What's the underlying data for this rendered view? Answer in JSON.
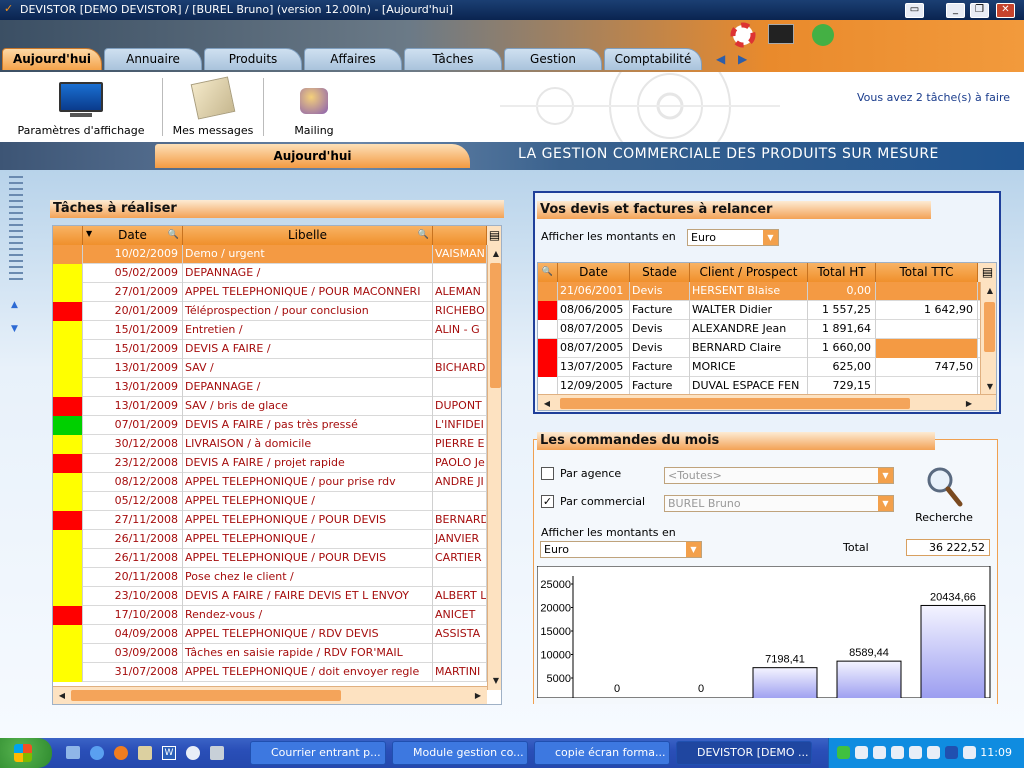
{
  "window": {
    "title": "DEVISTOR [DEMO DEVISTOR] / [BUREL Bruno] (version 12.00In) - [Aujourd'hui]"
  },
  "nav": {
    "tabs": [
      {
        "label": "Aujourd'hui",
        "active": true
      },
      {
        "label": "Annuaire"
      },
      {
        "label": "Produits"
      },
      {
        "label": "Affaires"
      },
      {
        "label": "Tâches"
      },
      {
        "label": "Gestion"
      },
      {
        "label": "Comptabilité"
      }
    ]
  },
  "toolbar": {
    "display_settings": "Paramètres d'affichage",
    "messages": "Mes messages",
    "mailing": "Mailing",
    "tasks_notice": "Vous avez 2 tâche(s) à faire"
  },
  "section": {
    "title": "Aujourd'hui",
    "slogan": "LA GESTION COMMERCIALE DES PRODUITS SUR MESURE"
  },
  "tasks": {
    "title": "Tâches à réaliser",
    "columns": {
      "date": "Date",
      "label": "Libelle"
    },
    "rows": [
      {
        "status": "orange",
        "date": "10/02/2009",
        "label": "Demo / urgent",
        "client": "VAISMAN",
        "selected": true
      },
      {
        "status": "yellow",
        "date": "05/02/2009",
        "label": "DEPANNAGE /",
        "client": ""
      },
      {
        "status": "yellow",
        "date": "27/01/2009",
        "label": "APPEL TELEPHONIQUE / POUR MACONNERI",
        "client": "ALEMAN"
      },
      {
        "status": "red",
        "date": "20/01/2009",
        "label": "Téléprospection / pour conclusion",
        "client": "RICHEBO"
      },
      {
        "status": "yellow",
        "date": "15/01/2009",
        "label": "Entretien /",
        "client": "ALIN  - G"
      },
      {
        "status": "yellow",
        "date": "15/01/2009",
        "label": "DEVIS A FAIRE /",
        "client": ""
      },
      {
        "status": "yellow",
        "date": "13/01/2009",
        "label": "SAV /",
        "client": "BICHARD"
      },
      {
        "status": "yellow",
        "date": "13/01/2009",
        "label": "DEPANNAGE /",
        "client": ""
      },
      {
        "status": "red",
        "date": "13/01/2009",
        "label": "SAV / bris de glace",
        "client": "DUPONT"
      },
      {
        "status": "green",
        "date": "07/01/2009",
        "label": "DEVIS A FAIRE / pas très pressé",
        "client": "L'INFIDEI"
      },
      {
        "status": "yellow",
        "date": "30/12/2008",
        "label": "LIVRAISON / à domicile",
        "client": "PIERRE E"
      },
      {
        "status": "red",
        "date": "23/12/2008",
        "label": "DEVIS A FAIRE / projet rapide",
        "client": "PAOLO Je"
      },
      {
        "status": "yellow",
        "date": "08/12/2008",
        "label": "APPEL TELEPHONIQUE / pour prise rdv",
        "client": "ANDRE JI"
      },
      {
        "status": "yellow",
        "date": "05/12/2008",
        "label": "APPEL TELEPHONIQUE /",
        "client": ""
      },
      {
        "status": "red",
        "date": "27/11/2008",
        "label": "APPEL TELEPHONIQUE / POUR DEVIS",
        "client": "BERNARD"
      },
      {
        "status": "yellow",
        "date": "26/11/2008",
        "label": "APPEL TELEPHONIQUE /",
        "client": "JANVIER"
      },
      {
        "status": "yellow",
        "date": "26/11/2008",
        "label": "APPEL TELEPHONIQUE / POUR DEVIS",
        "client": "CARTIER"
      },
      {
        "status": "yellow",
        "date": "20/11/2008",
        "label": "Pose chez le client /",
        "client": ""
      },
      {
        "status": "yellow",
        "date": "23/10/2008",
        "label": "DEVIS A FAIRE / FAIRE DEVIS ET L ENVOY",
        "client": "ALBERT L"
      },
      {
        "status": "red",
        "date": "17/10/2008",
        "label": "Rendez-vous /",
        "client": "ANICET"
      },
      {
        "status": "yellow",
        "date": "04/09/2008",
        "label": "APPEL TELEPHONIQUE / RDV DEVIS",
        "client": "ASSISTA"
      },
      {
        "status": "yellow",
        "date": "03/09/2008",
        "label": "Tâches en saisie rapide / RDV FOR'MAIL",
        "client": ""
      },
      {
        "status": "yellow",
        "date": "31/07/2008",
        "label": "APPEL TELEPHONIQUE / doit envoyer regle",
        "client": "MARTINI"
      }
    ]
  },
  "quotes": {
    "title": "Vos devis et factures à relancer",
    "amount_label": "Afficher les montants en",
    "currency": "Euro",
    "columns": {
      "date": "Date",
      "stage": "Stade",
      "client": "Client / Prospect",
      "total_ht": "Total HT",
      "total_ttc": "Total TTC"
    },
    "rows": [
      {
        "status": "orange",
        "date": "21/06/2001",
        "stage": "Devis",
        "client": "HERSENT Blaise",
        "total_ht": "0,00",
        "total_ttc": "",
        "selected": true
      },
      {
        "status": "red",
        "date": "08/06/2005",
        "stage": "Facture",
        "client": "WALTER Didier",
        "total_ht": "1 557,25",
        "total_ttc": "1 642,90"
      },
      {
        "status": "none",
        "date": "08/07/2005",
        "stage": "Devis",
        "client": "ALEXANDRE Jean",
        "total_ht": "1 891,64",
        "total_ttc": ""
      },
      {
        "status": "red",
        "date": "08/07/2005",
        "stage": "Devis",
        "client": "BERNARD Claire",
        "total_ht": "1 660,00",
        "total_ttc": "",
        "ttc_highlight": true
      },
      {
        "status": "red",
        "date": "13/07/2005",
        "stage": "Facture",
        "client": "MORICE",
        "total_ht": "625,00",
        "total_ttc": "747,50"
      },
      {
        "status": "none",
        "date": "12/09/2005",
        "stage": "Facture",
        "client": "DUVAL ESPACE FEN",
        "total_ht": "729,15",
        "total_ttc": ""
      }
    ]
  },
  "orders": {
    "title": "Les commandes du mois",
    "by_agency_label": "Par agence",
    "by_agency_checked": false,
    "agency_value": "<Toutes>",
    "by_salesperson_label": "Par commercial",
    "by_salesperson_checked": true,
    "salesperson_value": "BUREL Bruno",
    "search_label": "Recherche",
    "amount_label": "Afficher les montants en",
    "currency": "Euro",
    "total_label": "Total",
    "total_value": "36 222,52"
  },
  "chart_data": {
    "type": "bar",
    "yticks": [
      "25000",
      "20000",
      "15000",
      "10000",
      "5000"
    ],
    "ylim": [
      0,
      25000
    ],
    "values": [
      0,
      0,
      7198.41,
      8589.44,
      20434.66
    ],
    "data_labels": [
      "0",
      "0",
      "7198,41",
      "8589,44",
      "20434,66"
    ]
  },
  "taskbar": {
    "tasks": [
      "Courrier entrant p...",
      "Module gestion co...",
      "copie écran forma...",
      "DEVISTOR [DEMO ..."
    ],
    "clock": "11:09"
  },
  "colors": {
    "orange": "#f49a43",
    "yellow": "#ffff00",
    "red": "#ff0000",
    "green": "#00d000",
    "row_text": "#a50d0d"
  }
}
